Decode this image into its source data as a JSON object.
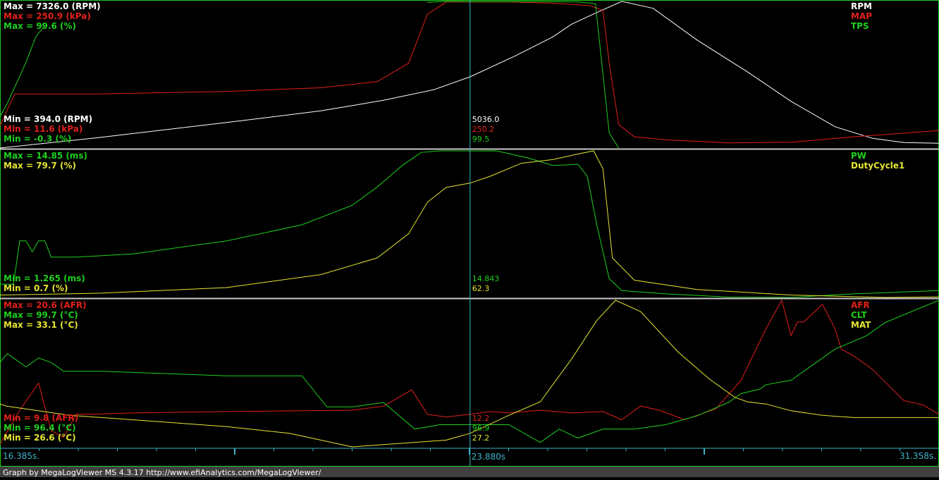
{
  "app": {
    "footer": "Graph by MegaLogViewer MS 4.3.17 http://www.efiAnalytics.com/MegaLogViewer/"
  },
  "colors": {
    "rpm": "#ffffff",
    "map": "#e0201a",
    "tps": "#1ed01e",
    "pw": "#1ed01e",
    "duty": "#e6e632",
    "afr": "#e0201a",
    "clt": "#1ed01e",
    "mat": "#e6e632",
    "cursor": "#3cb4c8",
    "axis": "#3cb4c8",
    "separator": "#c8c8c8",
    "footer_bg": "#404040"
  },
  "timeline": {
    "start": "16.385s.",
    "cursor": "23.880s",
    "end": "31.358s."
  },
  "panels": [
    {
      "series": [
        {
          "name": "RPM",
          "max_label": "Max = 7326.0 (RPM)",
          "min_label": "Min = 394.0 (RPM)",
          "cursor_value": "5036.0",
          "color": "#ffffff"
        },
        {
          "name": "MAP",
          "max_label": "Max = 250.9 (kPa)",
          "min_label": "Min = 11.6 (kPa)",
          "cursor_value": "250.2",
          "color": "#e0201a"
        },
        {
          "name": "TPS",
          "max_label": "Max = 99.6 (%)",
          "min_label": "Min = -0.3 (%)",
          "cursor_value": "99.5",
          "color": "#1ed01e"
        }
      ]
    },
    {
      "series": [
        {
          "name": "PW",
          "max_label": "Max = 14.85 (ms)",
          "min_label": "Min = 1.265 (ms)",
          "cursor_value": "14.843",
          "color": "#1ed01e"
        },
        {
          "name": "DutyCycle1",
          "max_label": "Max = 79.7 (%)",
          "min_label": "Min = 0.7 (%)",
          "cursor_value": "62.3",
          "color": "#e6e632"
        }
      ]
    },
    {
      "series": [
        {
          "name": "AFR",
          "max_label": "Max = 20.6 (AFR)",
          "min_label": "Min = 9.8 (AFR)",
          "cursor_value": "12.2",
          "color": "#e0201a"
        },
        {
          "name": "CLT",
          "max_label": "Max = 99.7 (°C)",
          "min_label": "Min = 96.4 (°C)",
          "cursor_value": "96.9",
          "color": "#1ed01e"
        },
        {
          "name": "MAT",
          "max_label": "Max = 33.1 (°C)",
          "min_label": "Min = 26.6 (°C)",
          "cursor_value": "27.2",
          "color": "#e6e632"
        }
      ]
    }
  ],
  "chart_data": {
    "type": "line",
    "x_unit": "s",
    "xlim": [
      16.385,
      31.358
    ],
    "cursor_x": 23.88,
    "charts": [
      {
        "series": [
          {
            "name": "RPM",
            "ylim": [
              394.0,
              7326.0
            ],
            "x": [
              16.385,
              18.0,
              20.0,
              21.5,
              22.5,
              23.3,
              23.88,
              24.6,
              25.2,
              25.5,
              25.9,
              26.3,
              26.8,
              27.5,
              28.3,
              29.0,
              29.7,
              30.3,
              30.8,
              31.358
            ],
            "values": [
              394,
              900,
              1600,
              2150,
              2650,
              3150,
              3760,
              4750,
              5650,
              6250,
              6800,
              7326,
              7000,
              5500,
              4000,
              2600,
              1400,
              850,
              650,
              620
            ]
          },
          {
            "name": "MAP",
            "ylim": [
              11.6,
              250.9
            ],
            "x": [
              16.385,
              16.62,
              18.0,
              20.0,
              21.5,
              22.4,
              22.9,
              23.2,
              23.5,
              23.88,
              24.5,
              25.2,
              25.8,
              26.0,
              26.1,
              26.25,
              26.5,
              27.0,
              28.0,
              29.0,
              30.0,
              31.358
            ],
            "values": [
              48,
              100,
              100,
              104,
              110,
              120,
              150,
              230,
              250,
              250,
              250,
              248,
              244,
              236,
              150,
              50,
              30,
              25,
              20,
              21,
              30,
              40
            ]
          },
          {
            "name": "TPS",
            "ylim": [
              -0.3,
              99.6
            ],
            "x": [
              16.385,
              16.5,
              16.8,
              16.95,
              17.0,
              17.1
            ],
            "values": [
              21,
              30,
              58,
              75,
              78,
              83
            ]
          },
          {
            "name": "TPS",
            "ylim": [
              -0.3,
              99.6
            ],
            "x": [
              23.2,
              23.5,
              23.88,
              24.5,
              25.0,
              25.6,
              25.88,
              25.95,
              26.1,
              26.25
            ],
            "values": [
              99,
              99.6,
              99.5,
              99.5,
              99.4,
              99.2,
              98,
              70,
              10,
              -0.3
            ]
          }
        ]
      },
      {
        "series": [
          {
            "name": "PW",
            "ylim": [
              1.265,
              14.85
            ],
            "x": [
              16.385,
              16.6,
              16.7,
              16.8,
              16.9,
              17.0,
              17.1,
              17.2,
              17.4,
              17.6,
              18.5,
              20.0,
              21.2,
              22.0,
              22.4,
              22.8,
              23.1,
              23.4,
              23.88,
              24.3,
              24.8,
              25.2,
              25.6,
              25.75,
              25.9,
              26.1,
              26.3,
              27.0,
              28.0,
              29.0,
              30.0,
              31.358
            ],
            "values": [
              2.5,
              2.5,
              6.5,
              6.5,
              5.5,
              6.5,
              6.5,
              5,
              5,
              5,
              5.3,
              6.5,
              8,
              9.8,
              11.5,
              13.5,
              14.7,
              14.85,
              14.843,
              14.85,
              14.2,
              13.5,
              13.6,
              12.5,
              8,
              3,
              1.9,
              1.6,
              1.3,
              1.265,
              1.6,
              1.9
            ]
          },
          {
            "name": "DutyCycle1",
            "ylim": [
              0.7,
              79.7
            ],
            "x": [
              16.385,
              18.0,
              20.0,
              21.5,
              22.4,
              22.9,
              23.2,
              23.5,
              23.88,
              24.2,
              24.7,
              25.2,
              25.6,
              25.85,
              26.0,
              26.15,
              26.5,
              27.5,
              29.0,
              30.5,
              31.358
            ],
            "values": [
              2,
              3,
              6,
              13,
              22,
              35,
              52,
              60,
              62.3,
              66,
              73,
              75,
              78,
              79.7,
              70,
              22,
              10,
              5,
              2,
              0.7,
              1
            ]
          }
        ]
      },
      {
        "series": [
          {
            "name": "AFR",
            "ylim": [
              9.8,
              20.6
            ],
            "x": [
              16.385,
              16.7,
              17.0,
              17.2,
              17.4,
              17.6,
              17.8,
              18.5,
              20.0,
              22.0,
              22.5,
              22.95,
              23.2,
              23.5,
              23.88,
              24.2,
              24.5,
              25.0,
              25.5,
              26.0,
              26.3,
              26.6,
              26.9,
              27.3,
              27.8,
              28.2,
              28.6,
              28.85,
              29.0,
              29.1,
              29.2,
              29.5,
              29.7,
              29.8,
              30.0,
              30.3,
              30.8,
              31.1,
              31.358
            ],
            "values": [
              10,
              12.5,
              14.5,
              11,
              10.5,
              12.2,
              12.2,
              12.3,
              12.4,
              12.5,
              12.8,
              14,
              12.2,
              12,
              12.2,
              12.4,
              12.3,
              12.5,
              12.3,
              12.4,
              11.8,
              12.8,
              12.5,
              11.8,
              12.6,
              14.7,
              18.5,
              20.6,
              18,
              19,
              19,
              20.3,
              18.5,
              17,
              16.5,
              15.5,
              13.2,
              12.9,
              12.2
            ]
          },
          {
            "name": "CLT",
            "ylim": [
              96.4,
              99.7
            ],
            "x": [
              16.385,
              16.5,
              16.8,
              17.0,
              17.2,
              17.4,
              17.7,
              18.0,
              20.0,
              21.2,
              21.6,
              22.0,
              22.5,
              23.0,
              23.4,
              23.88,
              24.5,
              25.0,
              25.3,
              25.6,
              26.0,
              26.5,
              27.0,
              27.5,
              28.0,
              28.2,
              28.5,
              28.6,
              29.0,
              29.4,
              29.7,
              30.2,
              30.5,
              31.358
            ],
            "values": [
              98.3,
              98.5,
              98.2,
              98.4,
              98.3,
              98.1,
              98.1,
              98.1,
              98.0,
              98.0,
              97.3,
              97.3,
              97.4,
              96.8,
              96.9,
              96.9,
              96.9,
              96.5,
              96.8,
              96.6,
              96.8,
              96.8,
              96.9,
              97.1,
              97.4,
              97.6,
              97.7,
              97.8,
              97.9,
              98.3,
              98.6,
              98.9,
              99.2,
              99.7
            ]
          },
          {
            "name": "MAT",
            "ylim": [
              26.6,
              33.1
            ],
            "x": [
              16.385,
              16.5,
              17.0,
              17.5,
              18.0,
              19.0,
              20.0,
              21.0,
              21.5,
              22.0,
              22.5,
              23.0,
              23.5,
              23.88,
              24.5,
              25.0,
              25.5,
              25.9,
              26.2,
              26.6,
              27.2,
              27.7,
              28.1,
              28.3,
              28.6,
              29.0,
              29.5,
              30.0,
              30.5,
              31.358
            ],
            "values": [
              28.5,
              28.4,
              28.2,
              28,
              27.9,
              27.7,
              27.5,
              27.2,
              26.9,
              26.6,
              26.7,
              26.8,
              26.9,
              27.2,
              28,
              28.6,
              30.5,
              32.2,
              33.1,
              32.6,
              30.8,
              29.6,
              28.8,
              28.6,
              28.5,
              28.2,
              28,
              27.9,
              27.9,
              27.9
            ]
          }
        ]
      }
    ]
  }
}
